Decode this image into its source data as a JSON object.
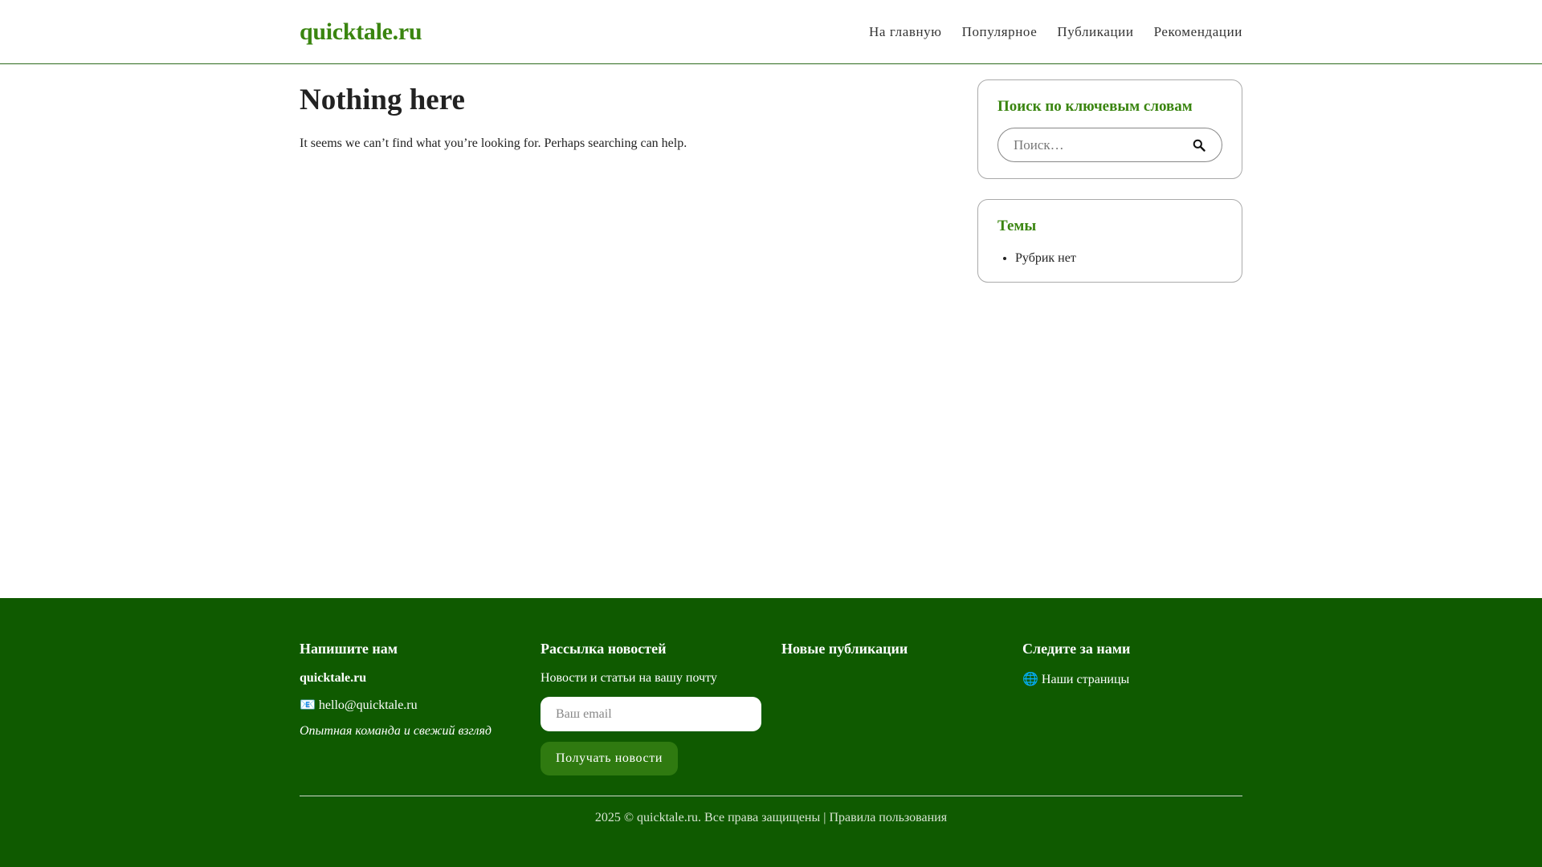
{
  "header": {
    "logo": "quicktale.ru",
    "nav": [
      {
        "label": "На главную"
      },
      {
        "label": "Популярное"
      },
      {
        "label": "Публикации"
      },
      {
        "label": "Рекомендации"
      }
    ]
  },
  "main": {
    "title": "Nothing here",
    "text": "It seems we can’t find what you’re looking for. Perhaps searching can help."
  },
  "sidebar": {
    "search_widget": {
      "title": "Поиск по ключевым словам",
      "placeholder": "Поиск…",
      "icon": "search-icon"
    },
    "topics_widget": {
      "title": "Темы",
      "items": [
        "Рубрик нет"
      ]
    }
  },
  "footer": {
    "contact": {
      "heading": "Напишите нам",
      "brand": "quicktale.ru",
      "email_icon": "📧",
      "email": "hello@quicktale.ru",
      "tagline": "Опытная команда и свежий взгляд"
    },
    "newsletter": {
      "heading": "Рассылка новостей",
      "text": "Новости и статьи на вашу почту",
      "email_placeholder": "Ваш email",
      "button": "Получать новости"
    },
    "new_posts": {
      "heading": "Новые публикации"
    },
    "follow": {
      "heading": "Следите за нами",
      "globe_icon": "🌐",
      "link": "Наши страницы"
    },
    "copyright": "2025 © quicktale.ru. Все права защищены",
    "separator": "|",
    "terms": "Правила пользования"
  },
  "colors": {
    "accent": "#3a8510",
    "footer_bg": "#0f5a00",
    "button_bg": "#2f7a10"
  }
}
